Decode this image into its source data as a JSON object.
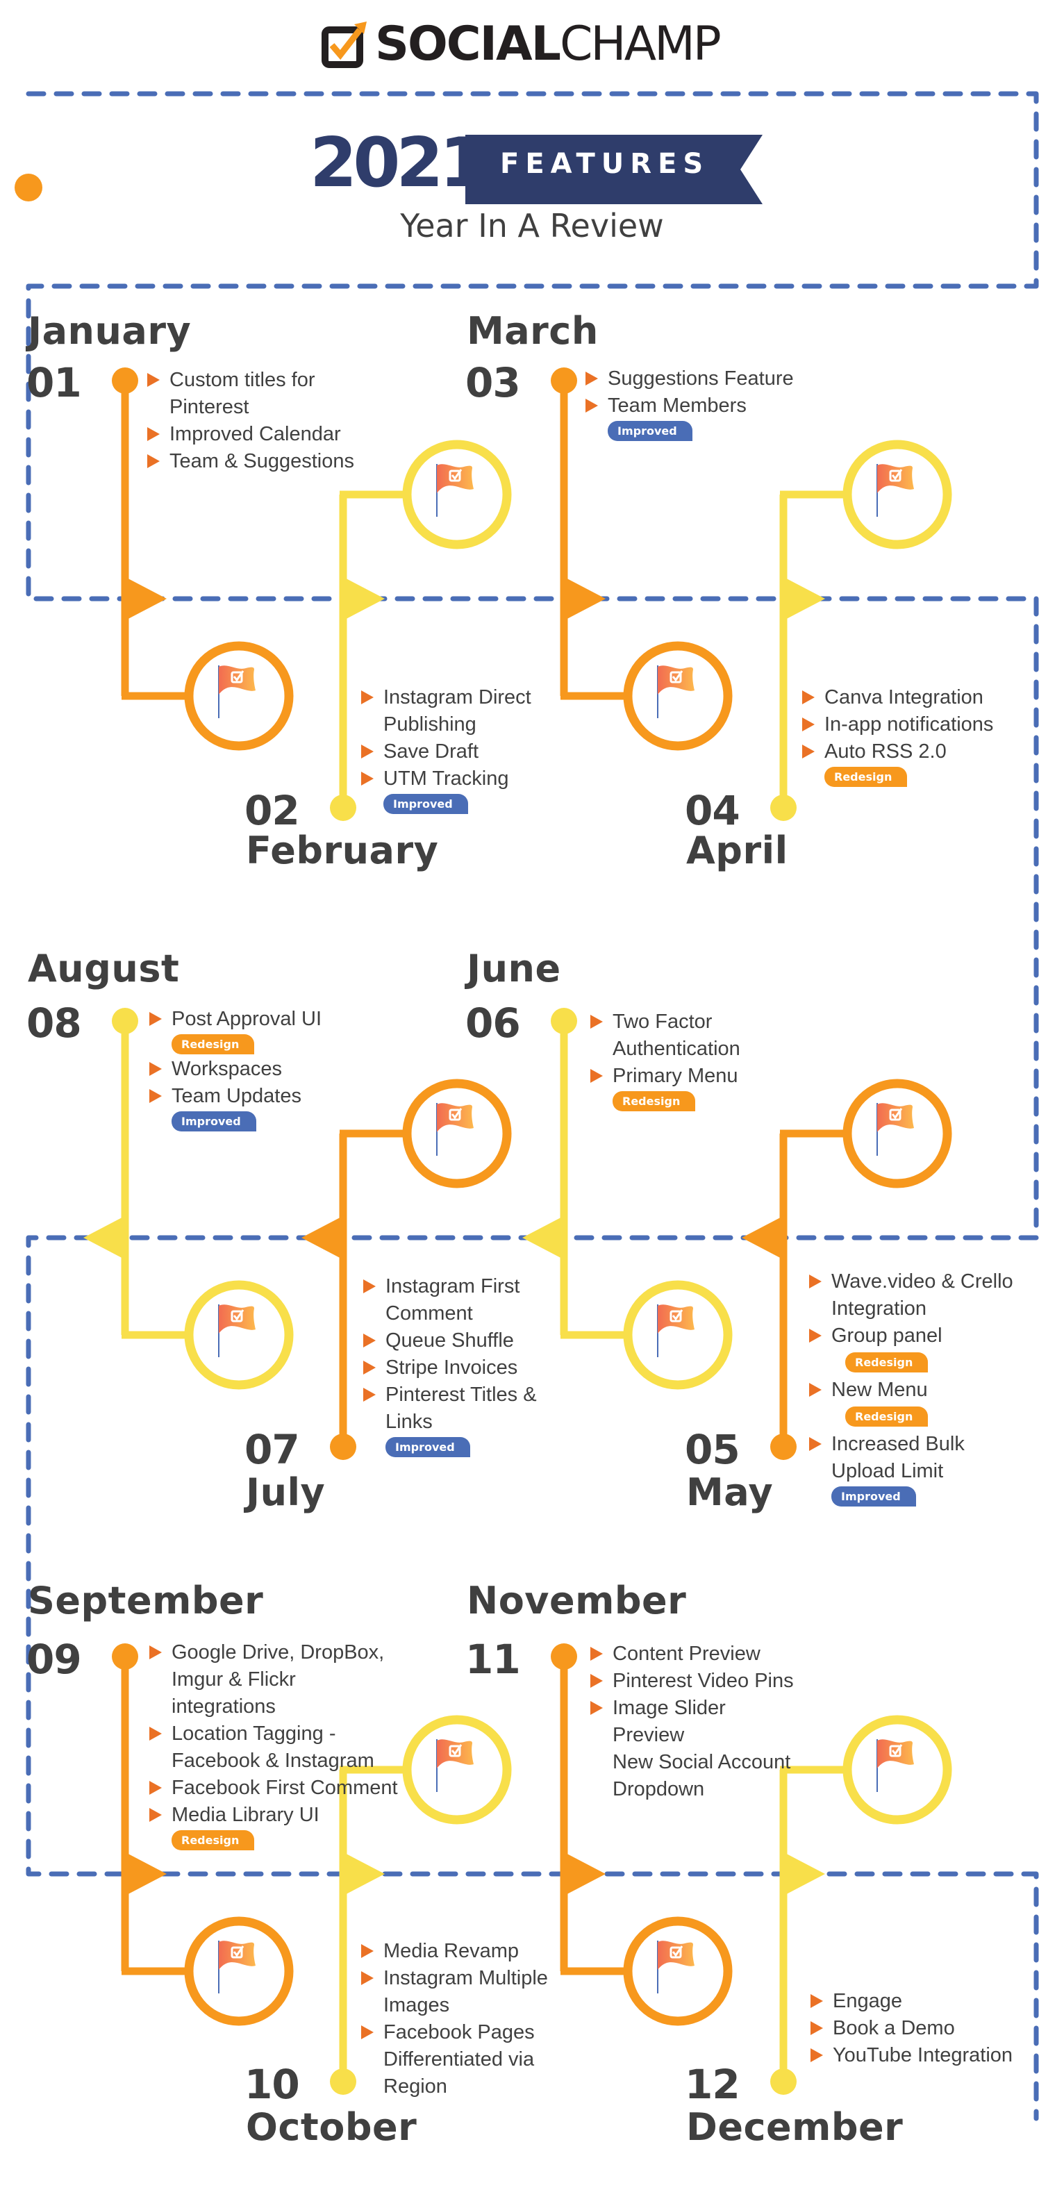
{
  "brand": {
    "name_bold": "SOCIAL",
    "name_light": "CHAMP",
    "logo_icon": "checkbox-arrow-icon"
  },
  "header": {
    "year": "2021",
    "banner_label": "FEATURES",
    "subtitle": "Year In A Review"
  },
  "colors": {
    "navy": "#2f3d6b",
    "dash_blue": "#4a6db6",
    "orange": "#f7981d",
    "yellow": "#f8df4a",
    "bullet_orange": "#ea7125",
    "text_dark": "#404040",
    "improved_badge": "#4a6db6",
    "redesign_badge": "#f7981d"
  },
  "badges": {
    "improved": "Improved",
    "redesign": "Redesign"
  },
  "months": [
    {
      "num": "01",
      "name": "January",
      "color": "orange",
      "features": [
        {
          "text": "Custom titles for Pinterest"
        },
        {
          "text": "Improved Calendar"
        },
        {
          "text": "Team & Suggestions"
        }
      ]
    },
    {
      "num": "02",
      "name": "February",
      "color": "yellow",
      "features": [
        {
          "text": "Instagram Direct Publishing"
        },
        {
          "text": "Save Draft"
        },
        {
          "text": "UTM Tracking",
          "badge": "improved",
          "badge_pos": "below"
        }
      ]
    },
    {
      "num": "03",
      "name": "March",
      "color": "orange",
      "features": [
        {
          "text": "Suggestions Feature"
        },
        {
          "text": "Team Members",
          "badge": "improved",
          "badge_pos": "below"
        }
      ]
    },
    {
      "num": "04",
      "name": "April",
      "color": "yellow",
      "features": [
        {
          "text": "Canva Integration"
        },
        {
          "text": "In-app notifications"
        },
        {
          "text": "Auto RSS 2.0",
          "badge": "redesign",
          "badge_pos": "below"
        }
      ]
    },
    {
      "num": "05",
      "name": "May",
      "color": "orange",
      "features": [
        {
          "text": "Wave.video & Crello Integration"
        },
        {
          "text": "Group panel",
          "badge": "redesign",
          "badge_pos": "inline"
        },
        {
          "text": "New Menu",
          "badge": "redesign",
          "badge_pos": "inline"
        },
        {
          "text": "Increased Bulk Upload Limit",
          "badge": "improved",
          "badge_pos": "below"
        }
      ]
    },
    {
      "num": "06",
      "name": "June",
      "color": "yellow",
      "features": [
        {
          "text": "Two Factor Authentication"
        },
        {
          "text": "Primary Menu",
          "badge": "redesign",
          "badge_pos": "below"
        }
      ]
    },
    {
      "num": "07",
      "name": "July",
      "color": "orange",
      "features": [
        {
          "text": "Instagram First Comment"
        },
        {
          "text": "Queue Shuffle"
        },
        {
          "text": "Stripe Invoices"
        },
        {
          "text": "Pinterest Titles & Links",
          "badge": "improved",
          "badge_pos": "below"
        }
      ]
    },
    {
      "num": "08",
      "name": "August",
      "color": "yellow",
      "features": [
        {
          "text": "Post Approval UI",
          "badge": "redesign",
          "badge_pos": "below"
        },
        {
          "text": "Workspaces"
        },
        {
          "text": "Team Updates",
          "badge": "improved",
          "badge_pos": "below"
        }
      ]
    },
    {
      "num": "09",
      "name": "September",
      "color": "orange",
      "features": [
        {
          "text": "Google Drive, DropBox, Imgur & Flickr  integrations"
        },
        {
          "text": "Location Tagging - Facebook & Instagram"
        },
        {
          "text": "Facebook First Comment"
        },
        {
          "text": "Media Library UI",
          "badge": "redesign",
          "badge_pos": "below"
        }
      ]
    },
    {
      "num": "10",
      "name": "October",
      "color": "yellow",
      "features": [
        {
          "text": "Media Revamp"
        },
        {
          "text": "Instagram Multiple Images"
        },
        {
          "text": "Facebook Pages Differentiated via Region"
        }
      ]
    },
    {
      "num": "11",
      "name": "November",
      "color": "orange",
      "features": [
        {
          "text": "Content Preview"
        },
        {
          "text": "Pinterest Video Pins"
        },
        {
          "text": "Image Slider Preview"
        },
        {
          "text": "New Social Account Dropdown",
          "no_bullet": true
        }
      ]
    },
    {
      "num": "12",
      "name": "December",
      "color": "yellow",
      "features": [
        {
          "text": "Engage"
        },
        {
          "text": "Book a Demo"
        },
        {
          "text": "YouTube Integration"
        }
      ]
    }
  ]
}
